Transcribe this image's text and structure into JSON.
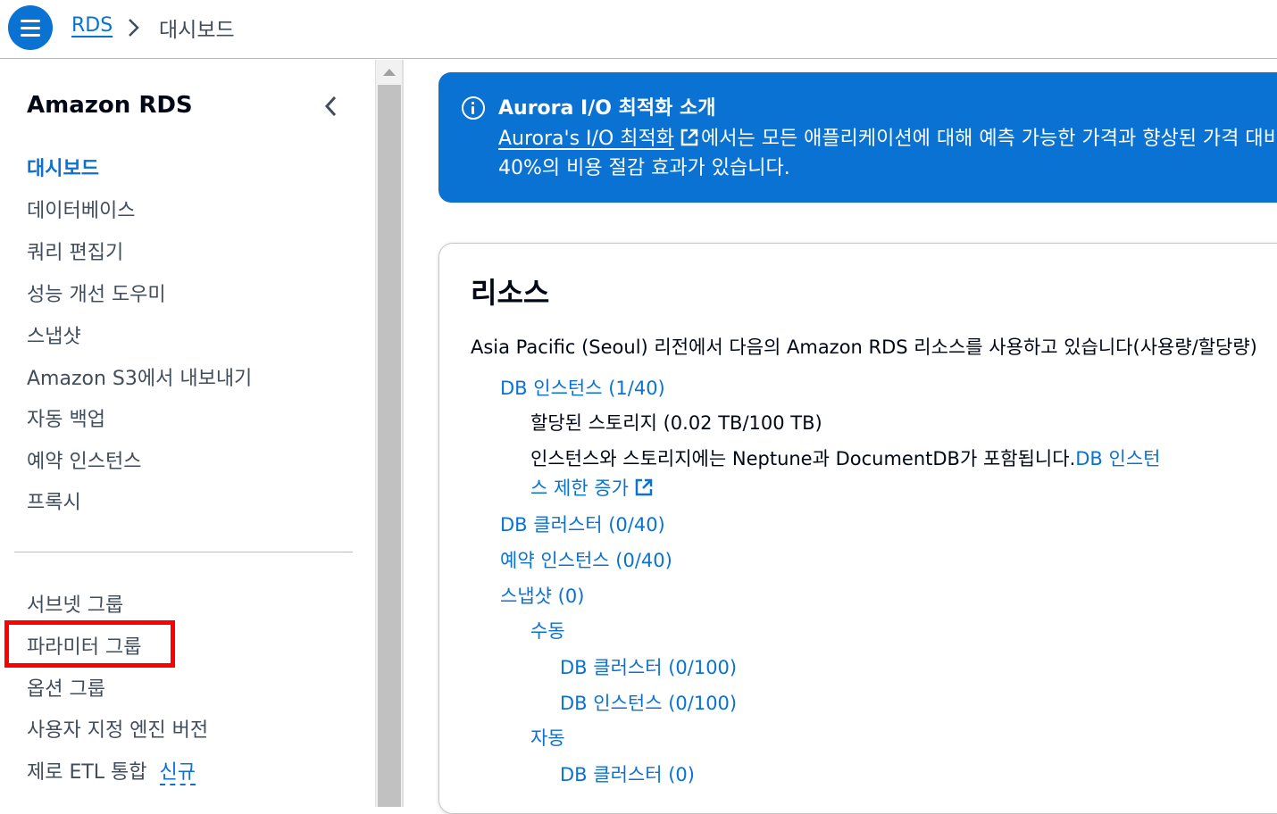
{
  "header": {
    "menu_icon": "hamburger-menu-icon",
    "breadcrumb": {
      "root": "RDS",
      "current": "대시보드"
    }
  },
  "sidebar": {
    "title": "Amazon RDS",
    "items": [
      {
        "label": "대시보드",
        "active": true
      },
      {
        "label": "데이터베이스"
      },
      {
        "label": "쿼리 편집기"
      },
      {
        "label": "성능 개선 도우미"
      },
      {
        "label": "스냅샷"
      },
      {
        "label": "Amazon S3에서 내보내기"
      },
      {
        "label": "자동 백업"
      },
      {
        "label": "예약 인스턴스"
      },
      {
        "label": "프록시"
      }
    ],
    "items2": [
      {
        "label": "서브넷 그룹"
      },
      {
        "label": "파라미터 그룹",
        "highlighted": true
      },
      {
        "label": "옵션 그룹"
      },
      {
        "label": "사용자 지정 엔진 버전"
      },
      {
        "label": "제로 ETL 통합",
        "badge": "신규"
      }
    ]
  },
  "banner": {
    "title": "Aurora I/O 최적화 소개",
    "link": "Aurora's I/O 최적화",
    "line1_rest": "에서는 모든 애플리케이션에 대해 예측 가능한 가격과 향상된 가격 대비 성능으로",
    "line2": "40%의 비용 절감 효과가 있습니다."
  },
  "resources": {
    "title": "리소스",
    "description": "Asia Pacific (Seoul) 리전에서 다음의 Amazon RDS 리소스를 사용하고 있습니다(사용량/할당량)",
    "db_instances": "DB 인스턴스 (1/40)",
    "allocated_storage": "할당된 스토리지 (0.02 TB/100 TB)",
    "storage_note": "인스턴스와 스토리지에는 Neptune과 DocumentDB가 포함됩니다.",
    "limit_link_part1": "DB 인스턴",
    "limit_link_part2": "스 제한 증가",
    "db_clusters": "DB 클러스터 (0/40)",
    "reserved_instances": "예약 인스턴스 (0/40)",
    "snapshots": "스냅샷 (0)",
    "manual": "수동",
    "manual_db_clusters": "DB 클러스터 (0/100)",
    "manual_db_instances": "DB 인스턴스 (0/100)",
    "automatic": "자동",
    "auto_db_clusters": "DB 클러스터 (0)"
  },
  "colors": {
    "accent": "#0972d3",
    "highlight": "#ff0000"
  }
}
